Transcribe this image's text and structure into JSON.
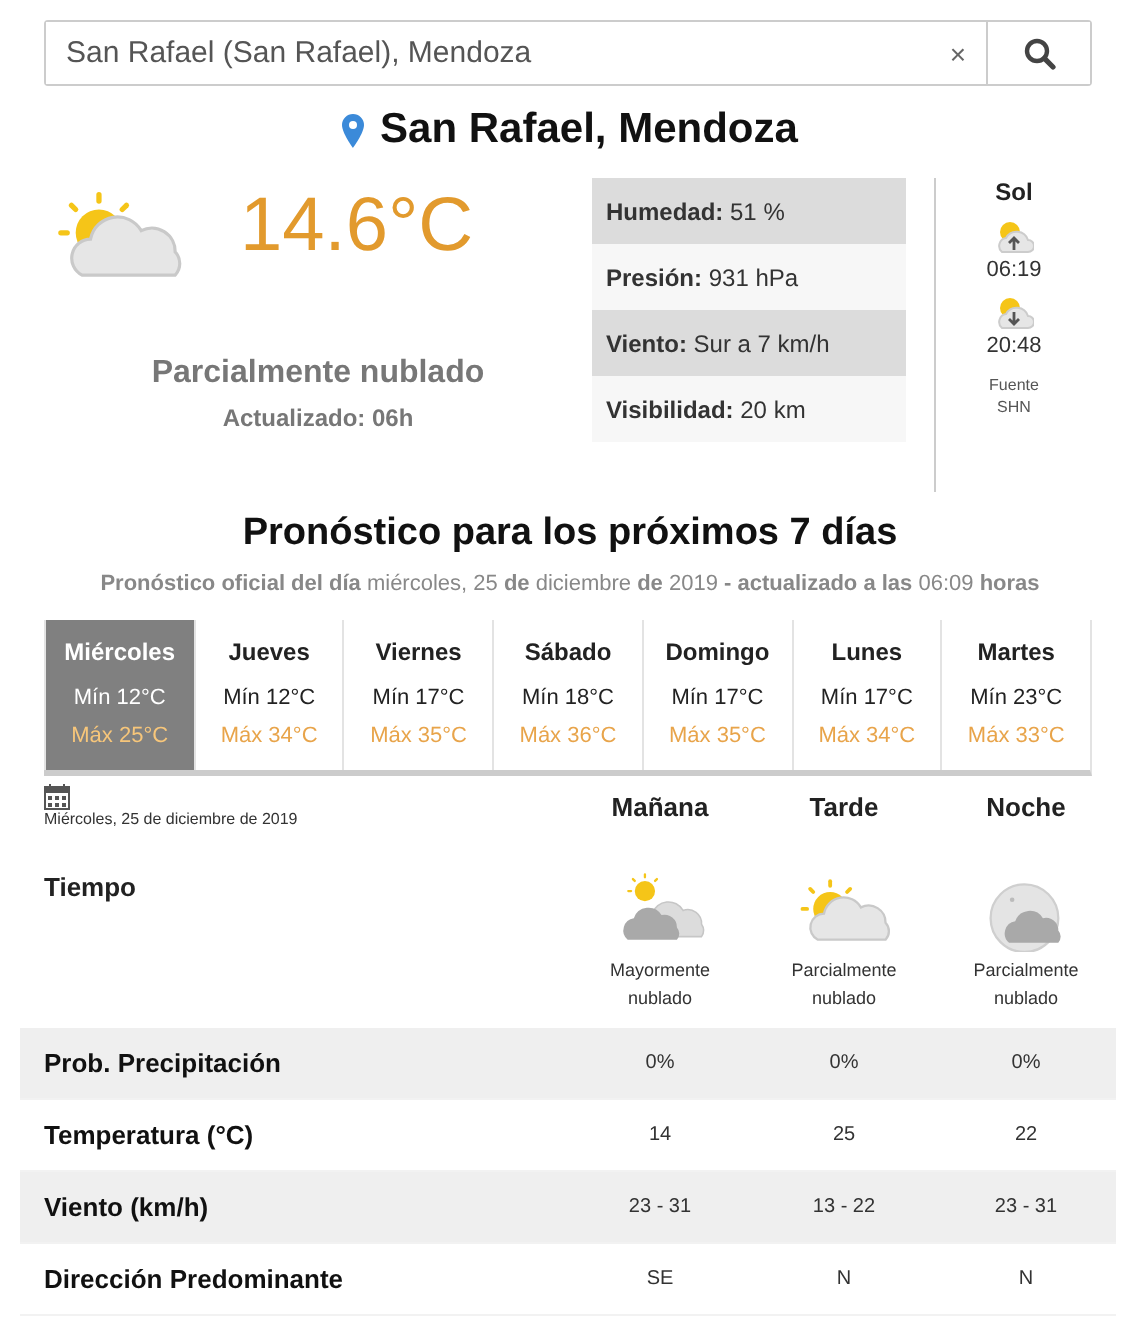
{
  "search": {
    "value": "San Rafael (San Rafael), Mendoza",
    "clear_label": "×"
  },
  "location": "San Rafael, Mendoza",
  "current": {
    "kind": "partly_cloudy",
    "temperature": "14.6°C",
    "condition": "Parcialmente nublado",
    "updated": "Actualizado: 06h"
  },
  "details": [
    {
      "label": "Humedad:",
      "value": "51 %"
    },
    {
      "label": "Presión:",
      "value": "931 hPa"
    },
    {
      "label": "Viento:",
      "value": "Sur a 7 km/h"
    },
    {
      "label": "Visibilidad:",
      "value": "20 km"
    }
  ],
  "sun": {
    "title": "Sol",
    "sunrise": "06:19",
    "sunset": "20:48",
    "source": "Fuente SHN"
  },
  "forecast": {
    "title": "Pronóstico para los próximos 7 días",
    "subtitle": "**Pronóstico oficial del día** miércoles, 25 **de** diciembre **de** 2019 **- actualizado a las** 06:09 **horas**",
    "days": [
      {
        "name": "Miércoles",
        "min": "Mín 12°C",
        "max": "Máx 25°C",
        "selected": true
      },
      {
        "name": "Jueves",
        "min": "Mín 12°C",
        "max": "Máx 34°C",
        "selected": false
      },
      {
        "name": "Viernes",
        "min": "Mín 17°C",
        "max": "Máx 35°C",
        "selected": false
      },
      {
        "name": "Sábado",
        "min": "Mín 18°C",
        "max": "Máx 36°C",
        "selected": false
      },
      {
        "name": "Domingo",
        "min": "Mín 17°C",
        "max": "Máx 35°C",
        "selected": false
      },
      {
        "name": "Lunes",
        "min": "Mín 17°C",
        "max": "Máx 34°C",
        "selected": false
      },
      {
        "name": "Martes",
        "min": "Mín 23°C",
        "max": "Máx 33°C",
        "selected": false
      }
    ],
    "date": "Miércoles, 25 de diciembre de 2019",
    "periods": [
      {
        "name": "Mañana",
        "kind": "mostly_cloudy",
        "condition": "Mayormente nublado"
      },
      {
        "name": "Tarde",
        "kind": "partly_cloudy",
        "condition": "Parcialmente nublado"
      },
      {
        "name": "Noche",
        "kind": "night_partly_cloudy",
        "condition": "Parcialmente nublado"
      }
    ],
    "weather_label": "Tiempo",
    "rows": [
      {
        "label": "Prob. Precipitación",
        "values": [
          "0%",
          "0%",
          "0%"
        ]
      },
      {
        "label": "Temperatura (°C)",
        "values": [
          "14",
          "25",
          "22"
        ]
      },
      {
        "label": "Viento (km/h)",
        "values": [
          "23 - 31",
          "13 - 22",
          "23 - 31"
        ]
      },
      {
        "label": "Dirección Predominante",
        "values": [
          "SE",
          "N",
          "N"
        ]
      }
    ]
  }
}
